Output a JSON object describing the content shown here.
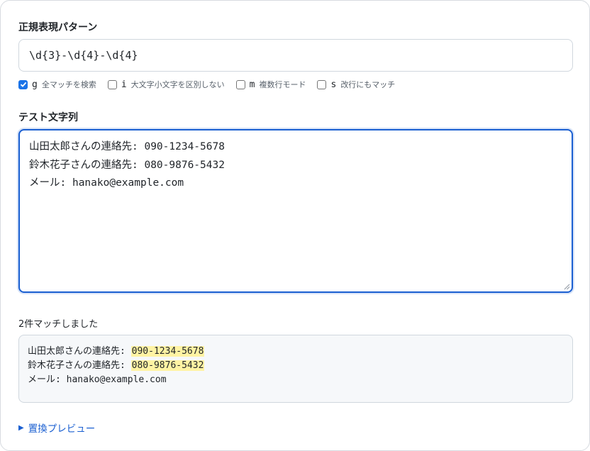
{
  "regex_section": {
    "label": "正規表現パターン",
    "pattern": "\\d{3}-\\d{4}-\\d{4}"
  },
  "flags": [
    {
      "letter": "g",
      "desc": "全マッチを検索",
      "checked": true
    },
    {
      "letter": "i",
      "desc": "大文字小文字を区別しない",
      "checked": false
    },
    {
      "letter": "m",
      "desc": "複数行モード",
      "checked": false
    },
    {
      "letter": "s",
      "desc": "改行にもマッチ",
      "checked": false
    }
  ],
  "test_section": {
    "label": "テスト文字列",
    "lines": [
      "山田太郎さんの連絡先: 090-1234-5678",
      "鈴木花子さんの連絡先: 080-9876-5432",
      "メール: hanako@example.com"
    ]
  },
  "result": {
    "count_text": "2件マッチしました",
    "lines": [
      {
        "prefix": "山田太郎さんの連絡先: ",
        "match": "090-1234-5678"
      },
      {
        "prefix": "鈴木花子さんの連絡先: ",
        "match": "080-9876-5432"
      },
      {
        "prefix": "メール: hanako@example.com",
        "match": ""
      }
    ]
  },
  "replace_preview": {
    "label": "置換プレビュー",
    "collapsed_icon": "triangle-right-icon"
  },
  "colors": {
    "accent": "#1a5fd1",
    "highlight": "#fff3a3",
    "result_bg": "#f6f8fa"
  }
}
